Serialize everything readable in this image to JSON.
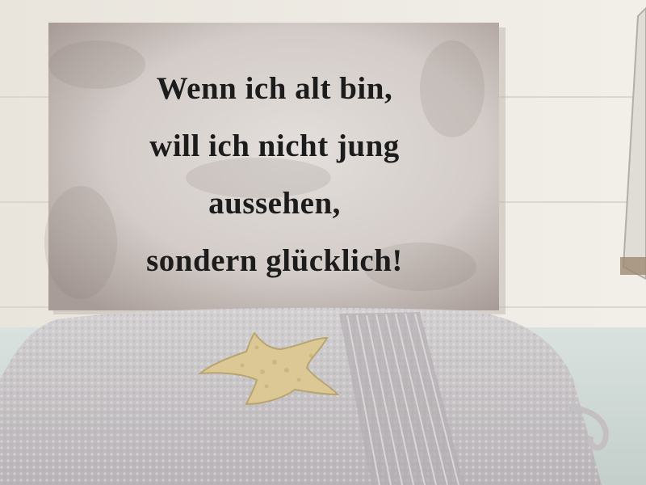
{
  "sign": {
    "lines": [
      "Wenn ich alt bin,",
      "will ich nicht jung",
      "aussehen,",
      "sondern glücklich!"
    ]
  },
  "colors": {
    "wall": "#ece8e0",
    "sign_background": "#d6d0cc",
    "sign_text": "#1c1c1c",
    "towel": "#c9c6c8",
    "starfish": "#d9c48e"
  },
  "objects": [
    "wall",
    "sign",
    "towel",
    "starfish",
    "mirror-edge"
  ]
}
